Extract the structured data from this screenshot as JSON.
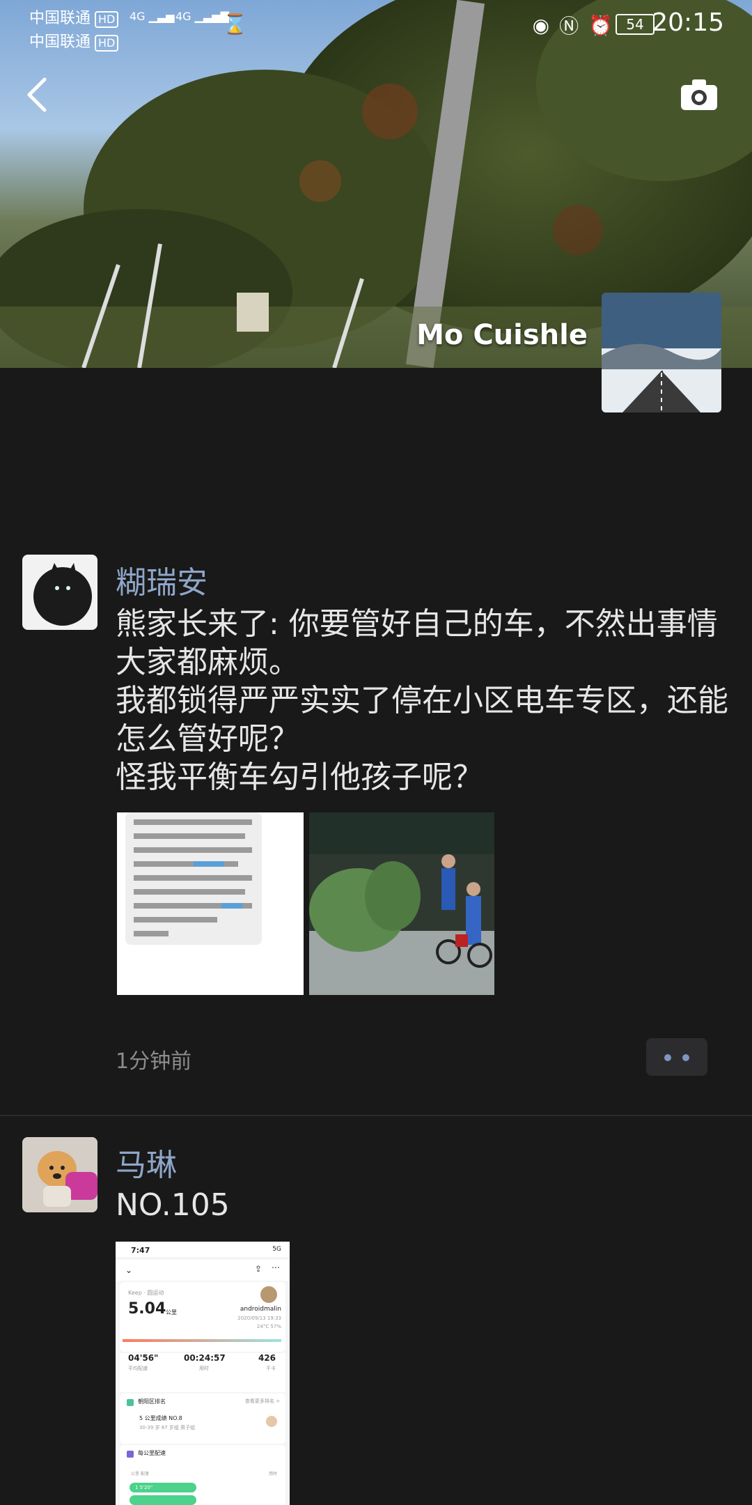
{
  "status_bar": {
    "carrier1": "中国联通",
    "carrier2": "中国联通",
    "hd_label": "HD",
    "net1": "4G",
    "net2": "4G",
    "battery": "54",
    "time": "20:15"
  },
  "cover": {
    "owner_name": "Mo Cuishle"
  },
  "posts": [
    {
      "author": "糊瑞安",
      "text": "熊家长来了: 你要管好自己的车，不然出事情大家都麻烦。\n我都锁得严严实实了停在小区电车专区，还能怎么管好呢？\n怪我平衡车勾引他孩子呢？",
      "time": "1分钟前",
      "images": [
        {
          "label": "screenshot-of-text-message"
        },
        {
          "label": "photo-kids-with-bike"
        }
      ]
    },
    {
      "author": "马琳",
      "text": "NO.105",
      "image": {
        "status_time": "7:47",
        "signal": "5G",
        "app_tag": "Keep · 圆运动",
        "distance": "5.04",
        "distance_unit": "公里",
        "user": "androidmalin",
        "date": "2020/09/13 19:33",
        "weather": "24°C  57%",
        "pace": "04'56\"",
        "pace_label": "平均配速",
        "duration": "00:24:57",
        "duration_label": "用时",
        "calories": "426",
        "calories_label": "千卡",
        "rank_title": "朝阳区排名",
        "rank_link": "查看更多排名 >",
        "rank_item": "5 公里成绩  NO.8",
        "rank_sub": "30-39 岁 87 岁组  男子组",
        "split_title": "每公里配速",
        "split_header1": "公里  配速",
        "split_header2": "用时",
        "split_value": "1  5'20\""
      }
    }
  ]
}
